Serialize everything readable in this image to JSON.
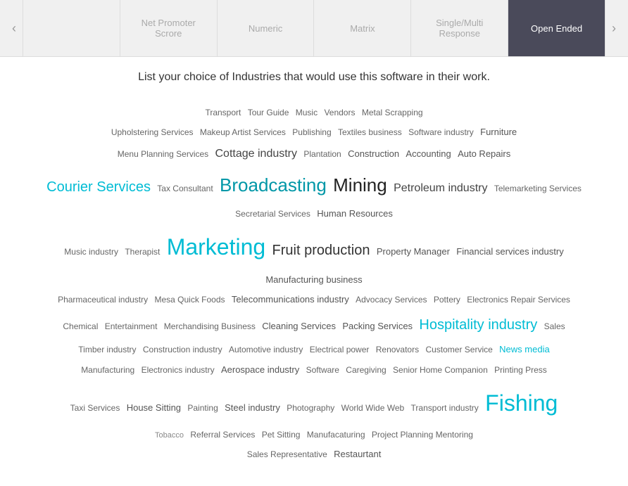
{
  "tabs": [
    {
      "id": "tab1",
      "label": "",
      "active": false
    },
    {
      "id": "tab2",
      "label": "Net Promoter Scrore",
      "active": false
    },
    {
      "id": "tab3",
      "label": "Numeric",
      "active": false
    },
    {
      "id": "tab4",
      "label": "Matrix",
      "active": false
    },
    {
      "id": "tab5",
      "label": "Single/Multi Response",
      "active": false
    },
    {
      "id": "tab6",
      "label": "Open Ended",
      "active": true
    }
  ],
  "question": "List your choice of Industries that would use this software in their work.",
  "arrows": {
    "left": "‹",
    "right": "›"
  },
  "words": [
    {
      "text": "Transport",
      "size": "size-sm"
    },
    {
      "text": "Tour Guide",
      "size": "size-sm"
    },
    {
      "text": "Music",
      "size": "size-sm"
    },
    {
      "text": "Vendors",
      "size": "size-sm"
    },
    {
      "text": "Metal Scrapping",
      "size": "size-sm"
    },
    {
      "text": "Upholstering Services",
      "size": "size-sm"
    },
    {
      "text": "Makeup Artist Services",
      "size": "size-sm"
    },
    {
      "text": "Publishing",
      "size": "size-sm"
    },
    {
      "text": "Textiles business",
      "size": "size-sm"
    },
    {
      "text": "Software industry",
      "size": "size-sm"
    },
    {
      "text": "Furniture",
      "size": "size-md"
    },
    {
      "text": "Menu Planning Services",
      "size": "size-sm"
    },
    {
      "text": "Cottage industry",
      "size": "size-lg"
    },
    {
      "text": "Construction",
      "size": "size-md"
    },
    {
      "text": "Accounting",
      "size": "size-md"
    },
    {
      "text": "Auto Repairs",
      "size": "size-sm"
    },
    {
      "text": "Courier Services",
      "size": "size-xl color-teal"
    },
    {
      "text": "Broadcasting",
      "size": "size-xxl color-teal-dark"
    },
    {
      "text": "Mining",
      "size": "size-xxl"
    },
    {
      "text": "Plantation",
      "size": "size-sm"
    },
    {
      "text": "Tax Consultant",
      "size": "size-sm"
    },
    {
      "text": "Petroleum industry",
      "size": "size-lg"
    },
    {
      "text": "Telemarketing Services",
      "size": "size-sm"
    },
    {
      "text": "Secretarial Services",
      "size": "size-sm"
    },
    {
      "text": "Human Resources",
      "size": "size-md"
    },
    {
      "text": "Music industry",
      "size": "size-sm"
    },
    {
      "text": "Therapist",
      "size": "size-sm"
    },
    {
      "text": "Marketing",
      "size": "size-xxxl color-teal"
    },
    {
      "text": "Fruit production",
      "size": "size-xl"
    },
    {
      "text": "Property Manager",
      "size": "size-md"
    },
    {
      "text": "Financial services industry",
      "size": "size-md"
    },
    {
      "text": "Manufacturing business",
      "size": "size-md"
    },
    {
      "text": "Pharmaceutical industry",
      "size": "size-sm"
    },
    {
      "text": "Mesa Quick Foods",
      "size": "size-sm"
    },
    {
      "text": "Telecommunications industry",
      "size": "size-md"
    },
    {
      "text": "Advocacy Services",
      "size": "size-sm"
    },
    {
      "text": "Pottery",
      "size": "size-sm"
    },
    {
      "text": "Electronics Repair Services",
      "size": "size-sm"
    },
    {
      "text": "Chemical",
      "size": "size-sm"
    },
    {
      "text": "Entertainment",
      "size": "size-sm"
    },
    {
      "text": "Merchandising Business",
      "size": "size-sm"
    },
    {
      "text": "Cleaning Services",
      "size": "size-md"
    },
    {
      "text": "Packing Services",
      "size": "size-md"
    },
    {
      "text": "Hospitality industry",
      "size": "size-xl color-teal"
    },
    {
      "text": "Sales",
      "size": "size-sm"
    },
    {
      "text": "Timber industry",
      "size": "size-sm"
    },
    {
      "text": "Construction industry",
      "size": "size-sm"
    },
    {
      "text": "Automotive industry",
      "size": "size-sm"
    },
    {
      "text": "Electrical power",
      "size": "size-sm"
    },
    {
      "text": "Renovators",
      "size": "size-sm"
    },
    {
      "text": "Customer Service",
      "size": "size-sm"
    },
    {
      "text": "News media",
      "size": "size-md color-teal"
    },
    {
      "text": "Manufacturing",
      "size": "size-sm"
    },
    {
      "text": "Electronics industry",
      "size": "size-sm"
    },
    {
      "text": "Aerospace industry",
      "size": "size-md"
    },
    {
      "text": "Software",
      "size": "size-sm"
    },
    {
      "text": "Caregiving",
      "size": "size-sm"
    },
    {
      "text": "Senior Home Companion",
      "size": "size-sm"
    },
    {
      "text": "Printing Press",
      "size": "size-sm"
    },
    {
      "text": "Taxi Services",
      "size": "size-sm"
    },
    {
      "text": "House Sitting",
      "size": "size-md"
    },
    {
      "text": "Painting",
      "size": "size-sm"
    },
    {
      "text": "Steel industry",
      "size": "size-md"
    },
    {
      "text": "Photography",
      "size": "size-sm"
    },
    {
      "text": "World Wide Web",
      "size": "size-sm"
    },
    {
      "text": "Transport industry",
      "size": "size-sm"
    },
    {
      "text": "Tobacco",
      "size": "size-xs"
    },
    {
      "text": "Referral Services",
      "size": "size-sm"
    },
    {
      "text": "Pet Sitting",
      "size": "size-sm"
    },
    {
      "text": "Manufacaturing",
      "size": "size-sm"
    },
    {
      "text": "Project Planning Mentoring",
      "size": "size-sm"
    },
    {
      "text": "Sales Representative",
      "size": "size-sm"
    },
    {
      "text": "Restaurtant",
      "size": "size-md"
    },
    {
      "text": "Fishing",
      "size": "size-xxxl color-teal"
    }
  ]
}
